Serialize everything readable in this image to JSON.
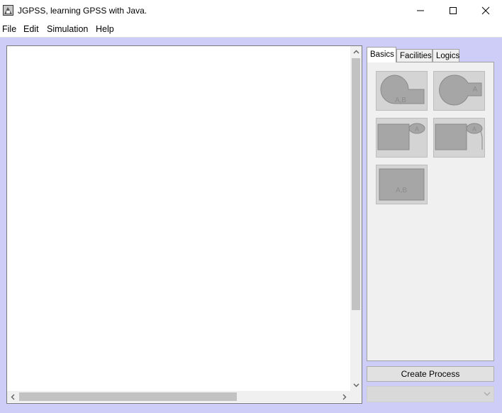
{
  "window": {
    "title": "JGPSS, learning GPSS with Java.",
    "controls": [
      "minimize",
      "maximize",
      "close"
    ]
  },
  "menu": {
    "items": [
      {
        "label": "File"
      },
      {
        "label": "Edit"
      },
      {
        "label": "Simulation"
      },
      {
        "label": "Help"
      }
    ]
  },
  "palette": {
    "tabs": [
      {
        "label": "Basics",
        "active": true
      },
      {
        "label": "Facilities",
        "active": false
      },
      {
        "label": "Logics",
        "active": false
      }
    ],
    "blocks": [
      {
        "name": "generate-block",
        "icon": "circle-tab-icon",
        "text": "A,B"
      },
      {
        "name": "terminate-block",
        "icon": "circle-tab-icon",
        "text": "A"
      },
      {
        "name": "seize-block",
        "icon": "rect-oval-icon",
        "text": "A"
      },
      {
        "name": "release-block",
        "icon": "rect-oval-icon",
        "text": "A"
      },
      {
        "name": "advance-block",
        "icon": "rect-icon",
        "text": "A,B"
      }
    ]
  },
  "actions": {
    "create_process_label": "Create Process",
    "process_select_value": ""
  },
  "colors": {
    "background": "#cdcdf7",
    "canvas": "#ffffff",
    "block_fill": "#a6a6a6"
  }
}
